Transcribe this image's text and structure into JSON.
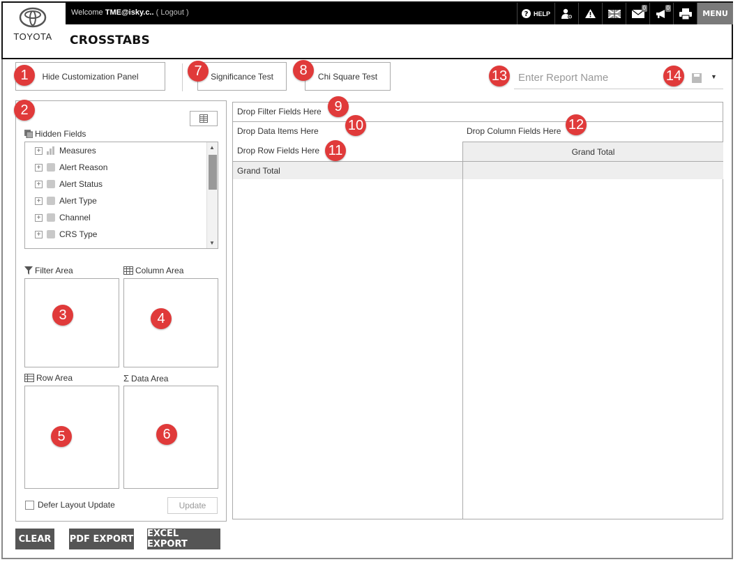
{
  "header": {
    "welcome_prefix": "Welcome",
    "user": "TME@isky.c..",
    "logout": "( Logout )",
    "help_label": "HELP",
    "mail_count": "0",
    "notification_count": "0",
    "menu_label": "MENU",
    "logo_text": "TOYOTA",
    "page_title": "CROSSTABS"
  },
  "toolbar": {
    "hide_panel_label": "Hide Customization Panel",
    "significance_label": "Significance Test",
    "chi_square_label": "Chi Square Test",
    "report_name_placeholder": "Enter Report Name"
  },
  "markers": [
    "1",
    "2",
    "3",
    "4",
    "5",
    "6",
    "7",
    "8",
    "9",
    "10",
    "11",
    "12",
    "13",
    "14"
  ],
  "panel": {
    "hidden_fields_label": "Hidden Fields",
    "fields": [
      {
        "label": "Measures",
        "icon": "bar-chart-icon"
      },
      {
        "label": "Alert Reason",
        "icon": "cube-icon"
      },
      {
        "label": "Alert Status",
        "icon": "cube-icon"
      },
      {
        "label": "Alert Type",
        "icon": "cube-icon"
      },
      {
        "label": "Channel",
        "icon": "cube-icon"
      },
      {
        "label": "CRS Type",
        "icon": "cube-icon"
      }
    ],
    "filter_area_label": "Filter Area",
    "column_area_label": "Column Area",
    "row_area_label": "Row Area",
    "data_area_label": "Data Area",
    "defer_label": "Defer Layout Update",
    "update_label": "Update"
  },
  "pivot": {
    "drop_filter": "Drop Filter Fields Here",
    "drop_data": "Drop Data Items Here",
    "drop_column": "Drop Column Fields Here",
    "drop_row": "Drop Row Fields Here",
    "grand_total_col": "Grand Total",
    "grand_total_row": "Grand Total"
  },
  "footer": {
    "clear_label": "CLEAR",
    "pdf_label": "PDF EXPORT",
    "excel_label": "EXCEL EXPORT"
  },
  "colors": {
    "marker": "#e03a3a",
    "topbar": "#000000",
    "button_dark": "#555555"
  }
}
